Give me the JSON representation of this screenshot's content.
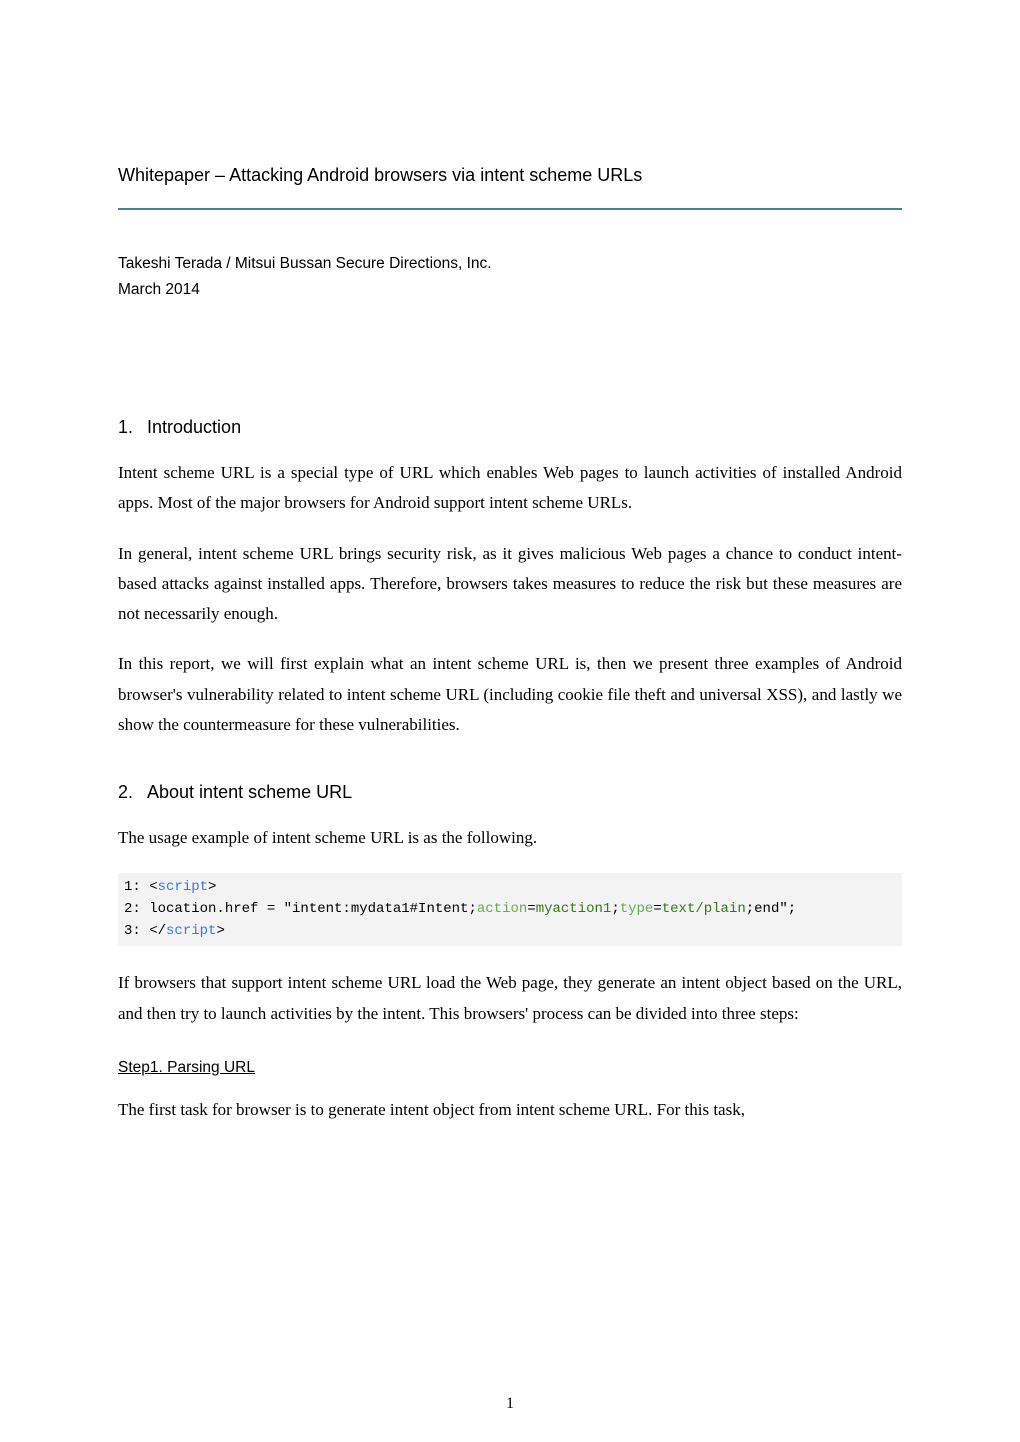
{
  "title": "Whitepaper – Attacking Android browsers via intent scheme URLs",
  "author": "Takeshi Terada / Mitsui Bussan Secure Directions, Inc.",
  "date": "March 2014",
  "section1": {
    "num": "1.",
    "heading": "Introduction",
    "p1": "Intent scheme URL is a special type of URL which enables Web pages to launch activities of installed Android apps. Most of the major browsers for Android support intent scheme URLs.",
    "p2": "In general, intent scheme URL brings security risk, as it gives malicious Web pages a chance to conduct intent-based attacks against installed apps. Therefore, browsers takes measures to reduce the risk but these measures are not necessarily enough.",
    "p3": "In this report, we will first explain what an intent scheme URL is, then we present three examples of Android browser's vulnerability related to intent scheme URL (including cookie file theft and universal XSS), and lastly we show the countermeasure for these vulnerabilities."
  },
  "section2": {
    "num": "2.",
    "heading": "About intent scheme URL",
    "p1": "The usage example of intent scheme URL is as the following.",
    "p2": "If browsers that support intent scheme URL load the Web page, they generate an intent object based on the URL, and then try to launch activities by the intent. This browsers' process can be divided into three steps:",
    "code": {
      "l1_pre": "1: <",
      "l1_tag": "script",
      "l1_post": ">",
      "l2_pre": "2: location.href = \"intent:mydata1#Intent;",
      "l2_a1": "action",
      "l2_eq1": "=",
      "l2_v1": "myaction1",
      "l2_sep": ";",
      "l2_a2": "type",
      "l2_eq2": "=",
      "l2_v2": "text/plain",
      "l2_post": ";end\";",
      "l3_pre": "3: </",
      "l3_tag": "script",
      "l3_post": ">"
    },
    "step1_heading": "Step1. Parsing URL",
    "step1_p1": "The first task for browser is to generate intent object from intent scheme URL. For this task,"
  },
  "pagenum": "1"
}
